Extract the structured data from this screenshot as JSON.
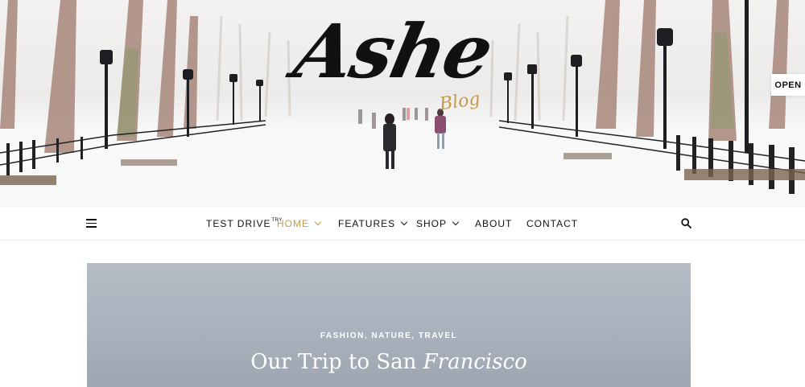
{
  "header": {
    "logo_title": "Ashe",
    "logo_subtitle": "Blog",
    "open_button": "OPEN"
  },
  "nav": {
    "items": [
      {
        "label": "TEST DRIVE",
        "badge": "TRY",
        "dropdown": false,
        "active": false
      },
      {
        "label": "HOME",
        "dropdown": true,
        "active": true
      },
      {
        "label": "FEATURES",
        "dropdown": true,
        "active": false
      },
      {
        "label": "SHOP",
        "dropdown": true,
        "active": false
      },
      {
        "label": "ABOUT",
        "dropdown": false,
        "active": false
      },
      {
        "label": "CONTACT",
        "dropdown": false,
        "active": false
      }
    ],
    "icons": {
      "menu": "hamburger-menu-icon",
      "search": "search-icon"
    }
  },
  "featured_post": {
    "categories": [
      "FASHION",
      "NATURE",
      "TRAVEL"
    ],
    "title_plain": "Our Trip to San",
    "title_italic": "Francisco"
  },
  "colors": {
    "accent": "#c59a4d",
    "text": "#111111",
    "featured_bg": "#aeb5c0"
  }
}
